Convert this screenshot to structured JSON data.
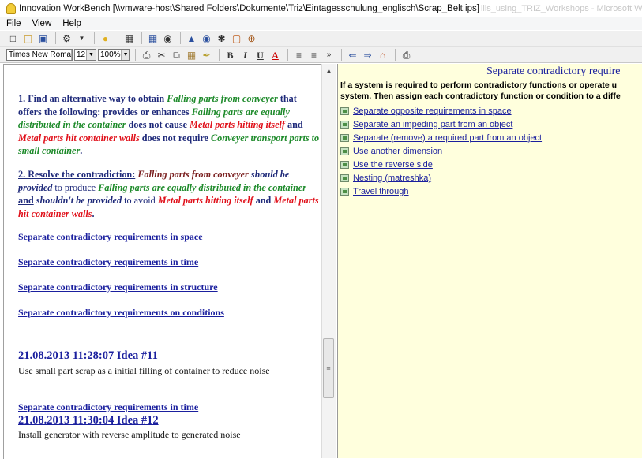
{
  "window": {
    "title": "Innovation WorkBench [\\\\vmware-host\\Shared Folders\\Dokumente\\Triz\\Eintagesschulung_englisch\\Scrap_Belt.ips]",
    "ghost_title": "ills_using_TRIZ_Workshops - Microsoft Word"
  },
  "menu": [
    "File",
    "View",
    "Help"
  ],
  "format_toolbar": {
    "font_name": "Times New Roma",
    "font_size": "12",
    "zoom": "100%",
    "bold": "B",
    "italic": "I",
    "underline": "U",
    "font_color": "A"
  },
  "colors": {
    "condition_green": "#1d8a2a",
    "harm_red": "#e0101a",
    "text_navy": "#1f2a7a",
    "link_blue": "#1a1f9e",
    "pane_bg": "#ffffdd"
  },
  "left": {
    "p1": {
      "lead": "1. Find an alternative way to obtain",
      "t1": "Falling parts from conveyer",
      "t2": "that offers the following: provides or enhances",
      "t3": "Falling parts are equally distributed in the container",
      "t4": "does not cause",
      "t5": "Metal parts hitting itself",
      "t6": "and",
      "t7": "Metal parts hit container walls",
      "t8": "does not require",
      "t9": "Conveyer transport parts to small container",
      "t10": "."
    },
    "p2": {
      "lead": "2. Resolve the contradiction:",
      "t1": "Falling parts from conveyer",
      "t2": "should be provided",
      "t3": "to produce",
      "t4": "Falling parts are equally distributed in the container",
      "t5": "and",
      "t6": "shouldn't be provided",
      "t7": "to avoid",
      "t8": "Metal parts hitting itself",
      "t9": "and",
      "t10": "Metal parts hit container walls",
      "t11": "."
    },
    "links": [
      "Separate contradictory requirements in space",
      "Separate contradictory requirements in time",
      "Separate contradictory requirements in structure",
      "Separate contradictory requirements on conditions"
    ],
    "idea11": {
      "header": "21.08.2013 11:28:07 Idea #11",
      "text": "Use small part scrap as a initial filling of container to reduce noise"
    },
    "link_time_2": "Separate contradictory requirements in time",
    "idea12": {
      "header": "21.08.2013 11:30:04 Idea #12",
      "text": "Install generator with reverse amplitude to generated noise"
    }
  },
  "right": {
    "heading": "Separate contradictory require",
    "intro_1": "If a system is required to perform contradictory functions or operate u",
    "intro_2": "system. Then assign each contradictory function or condition to a diffe",
    "items": [
      "Separate opposite requirements in space",
      "Separate an impeding part from an object",
      "Separate (remove) a required part from an object",
      "Use another dimension",
      "Use the reverse side",
      "Nesting (matreshka)",
      "Travel through"
    ]
  },
  "icons": [
    "new-icon",
    "open-icon",
    "save-icon",
    "tools-icon",
    "lightbulb-icon",
    "frame-icon",
    "table-icon",
    "binoculars-icon",
    "triz-icon",
    "help-icon",
    "settings-icon",
    "properties-icon",
    "target-icon",
    "print-icon",
    "cut-icon",
    "copy-icon",
    "paste-icon",
    "format-brush-icon",
    "align-left-icon",
    "bullets-icon",
    "back-icon",
    "forward-icon",
    "home-icon",
    "print-icon"
  ]
}
